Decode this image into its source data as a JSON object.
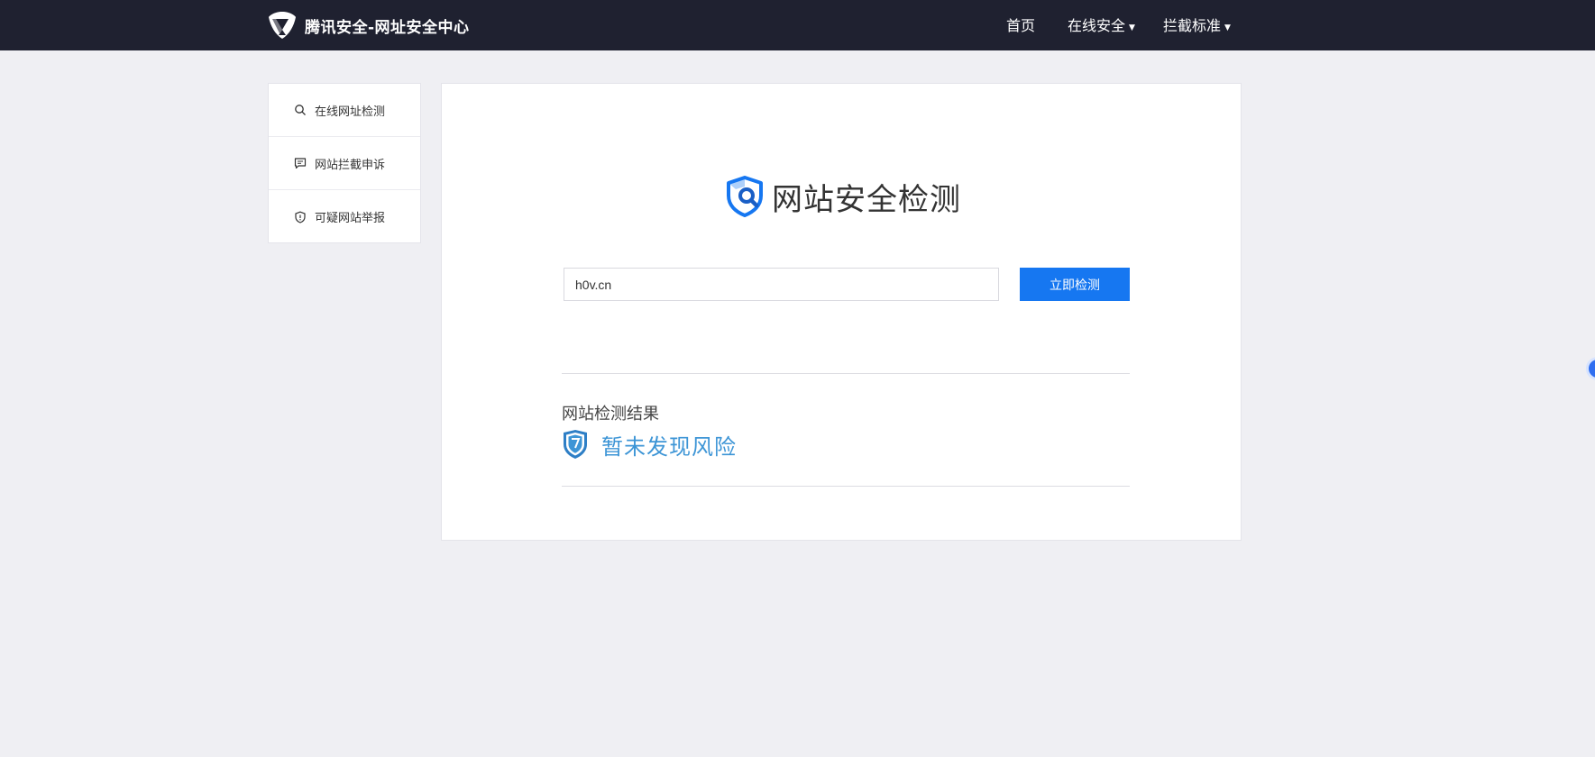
{
  "header": {
    "brand_title": "腾讯安全-网址安全中心",
    "logo_icon": "tencent-security-logo",
    "nav": [
      {
        "label": "首页",
        "has_dropdown": false
      },
      {
        "label": "在线安全",
        "has_dropdown": true
      },
      {
        "label": "拦截标准",
        "has_dropdown": true
      }
    ],
    "caret": "▼"
  },
  "sidebar": {
    "items": [
      {
        "label": "在线网址检测",
        "icon": "search-icon"
      },
      {
        "label": "网站拦截申诉",
        "icon": "chat-icon"
      },
      {
        "label": "可疑网站举报",
        "icon": "shield-alert-icon"
      }
    ]
  },
  "main": {
    "hero_title": "网站安全检测",
    "url_input_value": "h0v.cn",
    "check_button_label": "立即检测",
    "result_label": "网站检测结果",
    "result_text": "暂未发现风险"
  },
  "colors": {
    "topbar": "#1f2130",
    "accent": "#1677f1",
    "result_text": "#3d95d6",
    "background": "#efeff3"
  }
}
